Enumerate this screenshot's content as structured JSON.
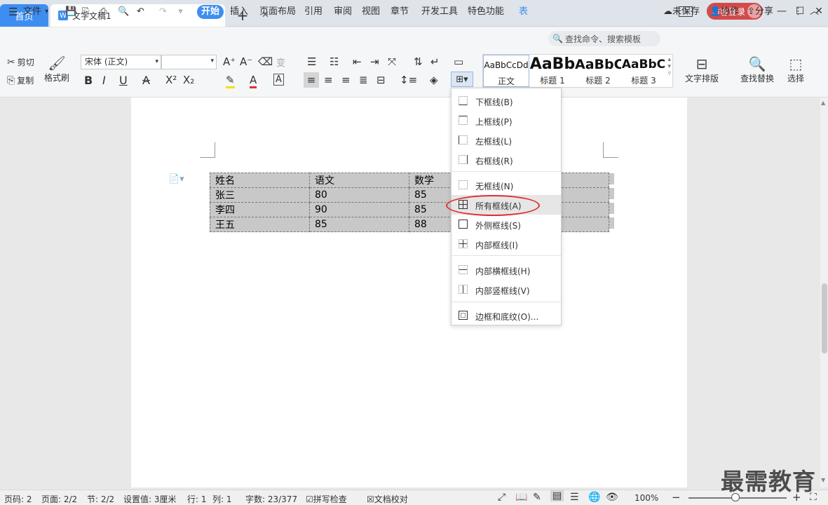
{
  "titlebar": {
    "home_tab": "首页",
    "doc_tab": "文字文稿1",
    "new_tab": "+",
    "page_indicator": "1",
    "login": "访客登录"
  },
  "menubar": {
    "file": "文件",
    "items": [
      "开始",
      "插入",
      "页面布局",
      "引用",
      "审阅",
      "视图",
      "章节",
      "开发工具",
      "特色功能",
      "表"
    ],
    "search_placeholder": "查找命令、搜索模板",
    "unsaved": "未保存",
    "collab": "协作",
    "share": "分享"
  },
  "ribbon": {
    "cut": "剪切",
    "copy": "复制",
    "format_painter": "格式刷",
    "font_name": "宋体 (正文)",
    "font_size": "",
    "styles": [
      {
        "preview": "AaBbCcDd",
        "label": "正文"
      },
      {
        "preview": "AaBb",
        "label": "标题 1"
      },
      {
        "preview": "AaBbC",
        "label": "标题 2"
      },
      {
        "preview": "AaBbC",
        "label": "标题 3"
      }
    ],
    "text_layout": "文字排版",
    "find_replace": "查找替换",
    "select": "选择"
  },
  "table": {
    "rows": [
      [
        "姓名",
        "语文",
        "数学",
        ""
      ],
      [
        "张三",
        "80",
        "85",
        ""
      ],
      [
        "李四",
        "90",
        "85",
        ""
      ],
      [
        "王五",
        "85",
        "88",
        ""
      ]
    ]
  },
  "border_menu": {
    "items": [
      "下框线(B)",
      "上框线(P)",
      "左框线(L)",
      "右框线(R)",
      "无框线(N)",
      "所有框线(A)",
      "外侧框线(S)",
      "内部框线(I)",
      "内部横框线(H)",
      "内部竖框线(V)",
      "边框和底纹(O)..."
    ],
    "highlighted": "所有框线(A)"
  },
  "statusbar": {
    "page_no": "页码: 2",
    "pages": "页面: 2/2",
    "section": "节: 2/2",
    "setting": "设置值: 3厘米",
    "row": "行: 1",
    "col": "列: 1",
    "words": "字数: 23/377",
    "spell": "拼写检查",
    "proof": "文档校对",
    "zoom": "100%",
    "minus": "−",
    "plus": "+"
  },
  "watermark": "最需教育"
}
